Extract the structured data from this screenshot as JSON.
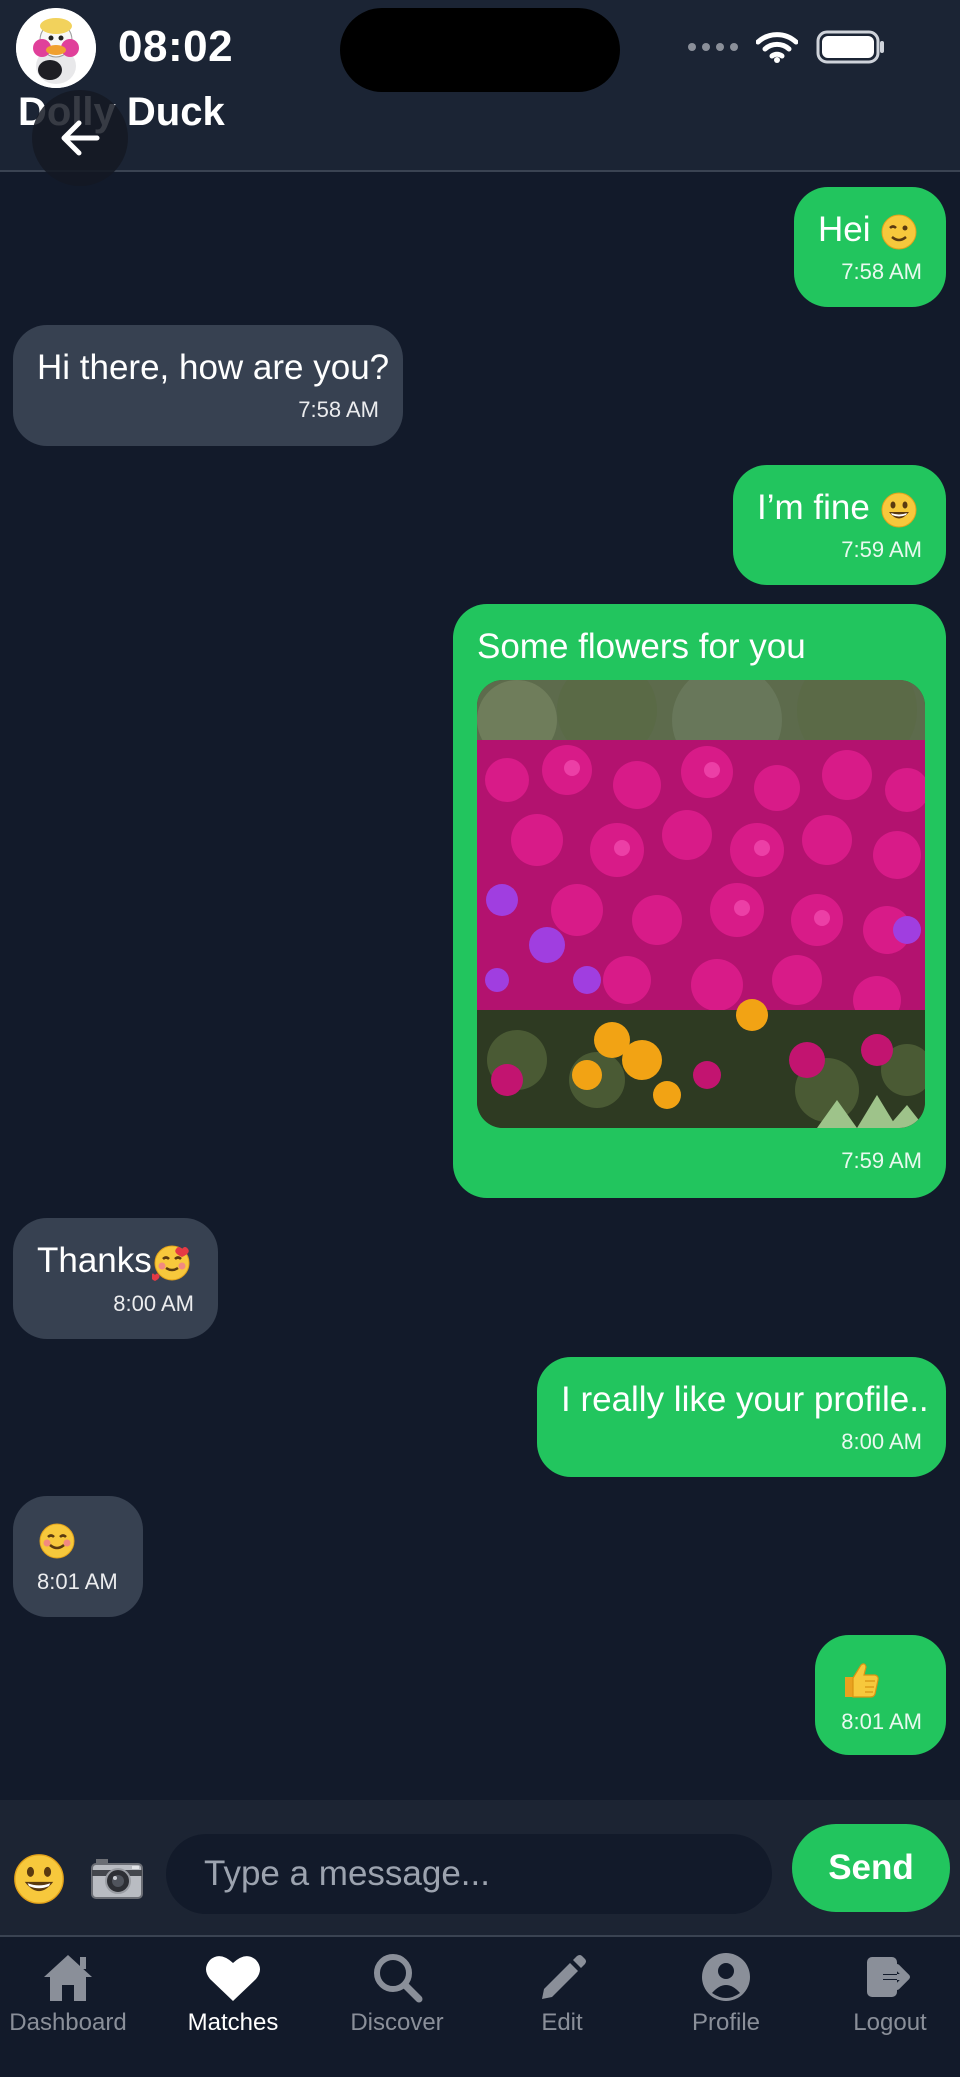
{
  "status_bar": {
    "time": "08:02"
  },
  "header": {
    "contact_name": "Dolly Duck"
  },
  "messages": [
    {
      "direction": "out",
      "text": "Hei",
      "emoji": "wink-emoji",
      "time": "7:58 AM"
    },
    {
      "direction": "in",
      "text": "Hi there, how are you?",
      "time": "7:58 AM"
    },
    {
      "direction": "out",
      "text": "I’m fine",
      "emoji": "grin-emoji",
      "time": "7:59 AM"
    },
    {
      "direction": "out",
      "text": "Some flowers for you",
      "image": "flowers-photo",
      "time": "7:59 AM"
    },
    {
      "direction": "in",
      "text": "Thanks",
      "emoji": "smiling-hearts-emoji",
      "time": "8:00 AM"
    },
    {
      "direction": "out",
      "text": "I really like your profile..",
      "time": "8:00 AM"
    },
    {
      "direction": "in",
      "text": "",
      "emoji": "blush-emoji",
      "time": "8:01 AM"
    },
    {
      "direction": "out",
      "text": "",
      "emoji": "thumbs-up-emoji",
      "time": "8:01 AM"
    }
  ],
  "composer": {
    "placeholder": "Type a message...",
    "send_label": "Send",
    "emoji_button_icon": "grin-emoji",
    "camera_button_icon": "camera-icon"
  },
  "tabs": [
    {
      "label": "Dashboard",
      "icon": "home-icon",
      "active": false
    },
    {
      "label": "Matches",
      "icon": "heart-icon",
      "active": true
    },
    {
      "label": "Discover",
      "icon": "search-icon",
      "active": false
    },
    {
      "label": "Edit",
      "icon": "pencil-icon",
      "active": false
    },
    {
      "label": "Profile",
      "icon": "user-circle-icon",
      "active": false
    },
    {
      "label": "Logout",
      "icon": "logout-icon",
      "active": false
    }
  ],
  "colors": {
    "background": "#121a2a",
    "outgoing_bubble": "#22c55e",
    "incoming_bubble": "#374151",
    "tab_inactive": "#8a8f99"
  }
}
